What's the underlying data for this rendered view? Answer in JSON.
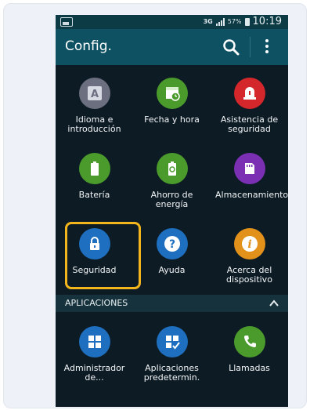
{
  "status_bar": {
    "network": "3G",
    "battery_pct": "57%",
    "time": "10:19"
  },
  "app_bar": {
    "title": "Config."
  },
  "settings": [
    {
      "label": "Idioma e introducción",
      "icon": "letter-a-icon",
      "color": "#6c6f80"
    },
    {
      "label": "Fecha y hora",
      "icon": "calendar-clock-icon",
      "color": "#4a9b2b"
    },
    {
      "label": "Asistencia de seguridad",
      "icon": "alert-siren-icon",
      "color": "#d4272c"
    },
    {
      "label": "Batería",
      "icon": "battery-icon",
      "color": "#4a9b2b"
    },
    {
      "label": "Ahorro de energía",
      "icon": "battery-recycle-icon",
      "color": "#4a9b2b"
    },
    {
      "label": "Almacenamiento",
      "icon": "sd-card-icon",
      "color": "#7b2fb3"
    },
    {
      "label": "Seguridad",
      "icon": "lock-icon",
      "color": "#1e6fbf"
    },
    {
      "label": "Ayuda",
      "icon": "help-icon",
      "color": "#1e6fbf"
    },
    {
      "label": "Acerca del dispositivo",
      "icon": "info-icon",
      "color": "#e2911a"
    }
  ],
  "apps_section": {
    "title": "APLICACIONES"
  },
  "apps": [
    {
      "label": "Administrador de...",
      "icon": "app-grid-icon",
      "color": "#1e6fbf"
    },
    {
      "label": "Aplicaciones predetermin.",
      "icon": "app-grid-check-icon",
      "color": "#1e6fbf"
    },
    {
      "label": "Llamadas",
      "icon": "phone-icon",
      "color": "#4a9b2b"
    }
  ],
  "highlight_color": "#f3b51c"
}
